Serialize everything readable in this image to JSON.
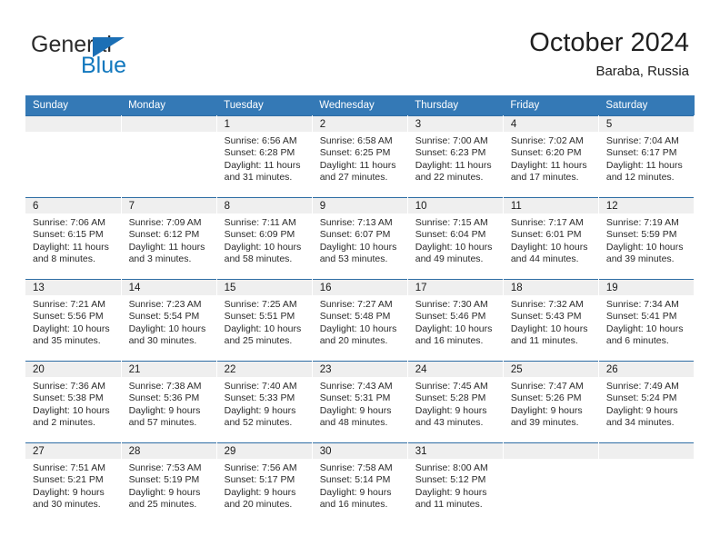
{
  "brand": {
    "name_top": "General",
    "name_bottom": "Blue",
    "color_top": "#2b2b2b",
    "color_bottom": "#1278be",
    "triangle_color": "#1b6fb5"
  },
  "header": {
    "title": "October 2024",
    "subtitle": "Baraba, Russia"
  },
  "theme": {
    "header_blue": "#3479b6",
    "row_divider_blue": "#2e6da4",
    "daynum_band": "#efefef",
    "text": "#2a2a2a"
  },
  "weekday_headers": [
    "Sunday",
    "Monday",
    "Tuesday",
    "Wednesday",
    "Thursday",
    "Friday",
    "Saturday"
  ],
  "weeks": [
    [
      {
        "day": "",
        "sunrise": "",
        "sunset": "",
        "daylight_line1": "",
        "daylight_line2": ""
      },
      {
        "day": "",
        "sunrise": "",
        "sunset": "",
        "daylight_line1": "",
        "daylight_line2": ""
      },
      {
        "day": "1",
        "sunrise": "Sunrise: 6:56 AM",
        "sunset": "Sunset: 6:28 PM",
        "daylight_line1": "Daylight: 11 hours",
        "daylight_line2": "and 31 minutes."
      },
      {
        "day": "2",
        "sunrise": "Sunrise: 6:58 AM",
        "sunset": "Sunset: 6:25 PM",
        "daylight_line1": "Daylight: 11 hours",
        "daylight_line2": "and 27 minutes."
      },
      {
        "day": "3",
        "sunrise": "Sunrise: 7:00 AM",
        "sunset": "Sunset: 6:23 PM",
        "daylight_line1": "Daylight: 11 hours",
        "daylight_line2": "and 22 minutes."
      },
      {
        "day": "4",
        "sunrise": "Sunrise: 7:02 AM",
        "sunset": "Sunset: 6:20 PM",
        "daylight_line1": "Daylight: 11 hours",
        "daylight_line2": "and 17 minutes."
      },
      {
        "day": "5",
        "sunrise": "Sunrise: 7:04 AM",
        "sunset": "Sunset: 6:17 PM",
        "daylight_line1": "Daylight: 11 hours",
        "daylight_line2": "and 12 minutes."
      }
    ],
    [
      {
        "day": "6",
        "sunrise": "Sunrise: 7:06 AM",
        "sunset": "Sunset: 6:15 PM",
        "daylight_line1": "Daylight: 11 hours",
        "daylight_line2": "and 8 minutes."
      },
      {
        "day": "7",
        "sunrise": "Sunrise: 7:09 AM",
        "sunset": "Sunset: 6:12 PM",
        "daylight_line1": "Daylight: 11 hours",
        "daylight_line2": "and 3 minutes."
      },
      {
        "day": "8",
        "sunrise": "Sunrise: 7:11 AM",
        "sunset": "Sunset: 6:09 PM",
        "daylight_line1": "Daylight: 10 hours",
        "daylight_line2": "and 58 minutes."
      },
      {
        "day": "9",
        "sunrise": "Sunrise: 7:13 AM",
        "sunset": "Sunset: 6:07 PM",
        "daylight_line1": "Daylight: 10 hours",
        "daylight_line2": "and 53 minutes."
      },
      {
        "day": "10",
        "sunrise": "Sunrise: 7:15 AM",
        "sunset": "Sunset: 6:04 PM",
        "daylight_line1": "Daylight: 10 hours",
        "daylight_line2": "and 49 minutes."
      },
      {
        "day": "11",
        "sunrise": "Sunrise: 7:17 AM",
        "sunset": "Sunset: 6:01 PM",
        "daylight_line1": "Daylight: 10 hours",
        "daylight_line2": "and 44 minutes."
      },
      {
        "day": "12",
        "sunrise": "Sunrise: 7:19 AM",
        "sunset": "Sunset: 5:59 PM",
        "daylight_line1": "Daylight: 10 hours",
        "daylight_line2": "and 39 minutes."
      }
    ],
    [
      {
        "day": "13",
        "sunrise": "Sunrise: 7:21 AM",
        "sunset": "Sunset: 5:56 PM",
        "daylight_line1": "Daylight: 10 hours",
        "daylight_line2": "and 35 minutes."
      },
      {
        "day": "14",
        "sunrise": "Sunrise: 7:23 AM",
        "sunset": "Sunset: 5:54 PM",
        "daylight_line1": "Daylight: 10 hours",
        "daylight_line2": "and 30 minutes."
      },
      {
        "day": "15",
        "sunrise": "Sunrise: 7:25 AM",
        "sunset": "Sunset: 5:51 PM",
        "daylight_line1": "Daylight: 10 hours",
        "daylight_line2": "and 25 minutes."
      },
      {
        "day": "16",
        "sunrise": "Sunrise: 7:27 AM",
        "sunset": "Sunset: 5:48 PM",
        "daylight_line1": "Daylight: 10 hours",
        "daylight_line2": "and 20 minutes."
      },
      {
        "day": "17",
        "sunrise": "Sunrise: 7:30 AM",
        "sunset": "Sunset: 5:46 PM",
        "daylight_line1": "Daylight: 10 hours",
        "daylight_line2": "and 16 minutes."
      },
      {
        "day": "18",
        "sunrise": "Sunrise: 7:32 AM",
        "sunset": "Sunset: 5:43 PM",
        "daylight_line1": "Daylight: 10 hours",
        "daylight_line2": "and 11 minutes."
      },
      {
        "day": "19",
        "sunrise": "Sunrise: 7:34 AM",
        "sunset": "Sunset: 5:41 PM",
        "daylight_line1": "Daylight: 10 hours",
        "daylight_line2": "and 6 minutes."
      }
    ],
    [
      {
        "day": "20",
        "sunrise": "Sunrise: 7:36 AM",
        "sunset": "Sunset: 5:38 PM",
        "daylight_line1": "Daylight: 10 hours",
        "daylight_line2": "and 2 minutes."
      },
      {
        "day": "21",
        "sunrise": "Sunrise: 7:38 AM",
        "sunset": "Sunset: 5:36 PM",
        "daylight_line1": "Daylight: 9 hours",
        "daylight_line2": "and 57 minutes."
      },
      {
        "day": "22",
        "sunrise": "Sunrise: 7:40 AM",
        "sunset": "Sunset: 5:33 PM",
        "daylight_line1": "Daylight: 9 hours",
        "daylight_line2": "and 52 minutes."
      },
      {
        "day": "23",
        "sunrise": "Sunrise: 7:43 AM",
        "sunset": "Sunset: 5:31 PM",
        "daylight_line1": "Daylight: 9 hours",
        "daylight_line2": "and 48 minutes."
      },
      {
        "day": "24",
        "sunrise": "Sunrise: 7:45 AM",
        "sunset": "Sunset: 5:28 PM",
        "daylight_line1": "Daylight: 9 hours",
        "daylight_line2": "and 43 minutes."
      },
      {
        "day": "25",
        "sunrise": "Sunrise: 7:47 AM",
        "sunset": "Sunset: 5:26 PM",
        "daylight_line1": "Daylight: 9 hours",
        "daylight_line2": "and 39 minutes."
      },
      {
        "day": "26",
        "sunrise": "Sunrise: 7:49 AM",
        "sunset": "Sunset: 5:24 PM",
        "daylight_line1": "Daylight: 9 hours",
        "daylight_line2": "and 34 minutes."
      }
    ],
    [
      {
        "day": "27",
        "sunrise": "Sunrise: 7:51 AM",
        "sunset": "Sunset: 5:21 PM",
        "daylight_line1": "Daylight: 9 hours",
        "daylight_line2": "and 30 minutes."
      },
      {
        "day": "28",
        "sunrise": "Sunrise: 7:53 AM",
        "sunset": "Sunset: 5:19 PM",
        "daylight_line1": "Daylight: 9 hours",
        "daylight_line2": "and 25 minutes."
      },
      {
        "day": "29",
        "sunrise": "Sunrise: 7:56 AM",
        "sunset": "Sunset: 5:17 PM",
        "daylight_line1": "Daylight: 9 hours",
        "daylight_line2": "and 20 minutes."
      },
      {
        "day": "30",
        "sunrise": "Sunrise: 7:58 AM",
        "sunset": "Sunset: 5:14 PM",
        "daylight_line1": "Daylight: 9 hours",
        "daylight_line2": "and 16 minutes."
      },
      {
        "day": "31",
        "sunrise": "Sunrise: 8:00 AM",
        "sunset": "Sunset: 5:12 PM",
        "daylight_line1": "Daylight: 9 hours",
        "daylight_line2": "and 11 minutes."
      },
      {
        "day": "",
        "sunrise": "",
        "sunset": "",
        "daylight_line1": "",
        "daylight_line2": ""
      },
      {
        "day": "",
        "sunrise": "",
        "sunset": "",
        "daylight_line1": "",
        "daylight_line2": ""
      }
    ]
  ]
}
